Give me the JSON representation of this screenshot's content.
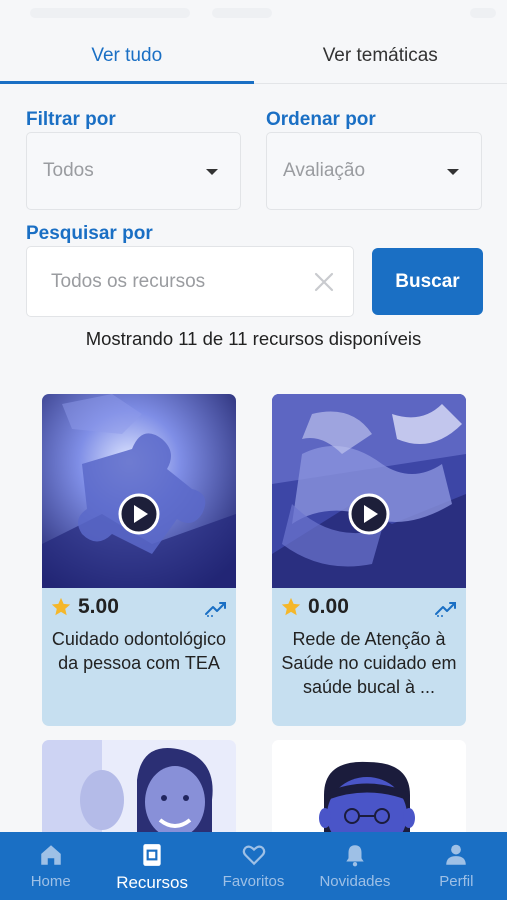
{
  "tabs": {
    "all": "Ver tudo",
    "themes": "Ver temáticas"
  },
  "filter": {
    "label": "Filtrar por",
    "value": "Todos"
  },
  "sort": {
    "label": "Ordenar por",
    "value": "Avaliação"
  },
  "search": {
    "label": "Pesquisar por",
    "placeholder": "Todos os recursos",
    "button": "Buscar"
  },
  "results_text": "Mostrando 11 de 11 recursos disponíveis",
  "cards": [
    {
      "rating": "5.00",
      "title": "Cuidado odontológico da pessoa com TEA",
      "thumb": "puzzle-image"
    },
    {
      "rating": "0.00",
      "title": "Rede de Atenção à Saúde no cuidado em saúde bucal à ...",
      "thumb": "hands-image"
    }
  ],
  "nav": [
    {
      "label": "Home",
      "icon": "home-icon",
      "active": false
    },
    {
      "label": "Recursos",
      "icon": "resources-icon",
      "active": true
    },
    {
      "label": "Favoritos",
      "icon": "heart-icon",
      "active": false
    },
    {
      "label": "Novidades",
      "icon": "bell-icon",
      "active": false
    },
    {
      "label": "Perfil",
      "icon": "person-icon",
      "active": false
    }
  ],
  "colors": {
    "accent": "#1a6fc4",
    "card_bg": "#c6dff0",
    "star": "#f5b72a"
  }
}
